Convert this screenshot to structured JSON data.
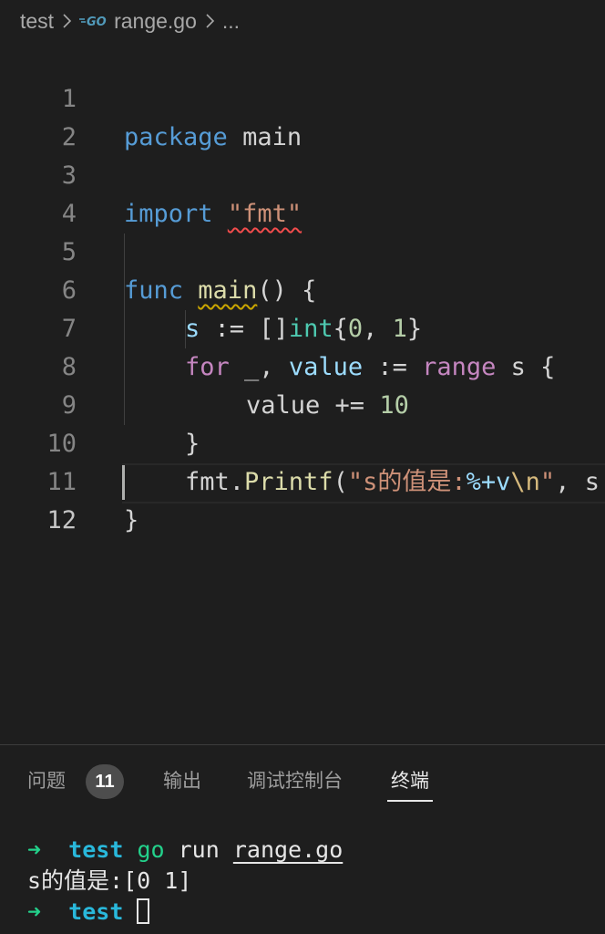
{
  "breadcrumb": {
    "folder": "test",
    "file": "range.go",
    "more": "...",
    "file_icon": "go-file-icon"
  },
  "editor": {
    "line_numbers": [
      "1",
      "2",
      "3",
      "4",
      "5",
      "6",
      "7",
      "8",
      "9",
      "10",
      "11",
      "12"
    ],
    "current_line": 12,
    "lines": {
      "l1": {
        "kw": "package",
        "name": "main"
      },
      "l3": {
        "kw": "import",
        "str": "\"fmt\""
      },
      "l5": {
        "kw": "func",
        "fn": "main",
        "rest": "() {"
      },
      "l6": {
        "var": "s",
        "op": " := []",
        "type": "int",
        "open": "{",
        "n0": "0",
        "comma": ", ",
        "n1": "1",
        "close": "}"
      },
      "l7": {
        "kw": "for",
        "blank": " _, ",
        "var": "value",
        "op": " := ",
        "range": "range",
        "rest": " s {"
      },
      "l8": {
        "var": "value",
        "op": " += ",
        "num": "10"
      },
      "l9": {
        "text": "}"
      },
      "l10": {
        "pkg": "fmt.",
        "fn": "Printf",
        "open": "(",
        "str1": "\"s的值是:",
        "fmtv": "%+v",
        "esc": "\\n",
        "str2": "\"",
        "rest": ", s"
      },
      "l11": {
        "text": "}"
      }
    }
  },
  "panel": {
    "tabs": [
      "问题",
      "输出",
      "调试控制台",
      "终端"
    ],
    "active_tab": "终端",
    "problems_count": "11",
    "terminal": {
      "line1": {
        "arrow": "➜",
        "dir": "test",
        "cmd": "go",
        "args": "run",
        "file": "range.go"
      },
      "line2": "s的值是:[0 1]",
      "line3": {
        "arrow": "➜",
        "dir": "test"
      }
    }
  },
  "colors": {
    "background": "#1e1e1e",
    "keyword": "#569cd6",
    "control": "#c586c0",
    "string": "#ce9178",
    "number": "#b5cea8",
    "function": "#dcdcaa",
    "variable": "#9cdcfe",
    "type": "#4ec9b0",
    "terminal_green": "#23d18b",
    "terminal_cyan": "#29b8db"
  }
}
